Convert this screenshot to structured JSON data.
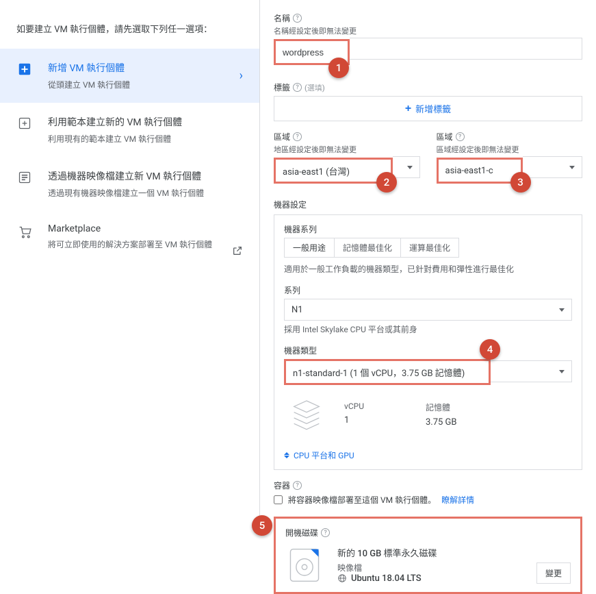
{
  "sidebar": {
    "intro": "如要建立 VM 執行個體，請先選取下列任一選項：",
    "items": [
      {
        "title": "新增 VM 執行個體",
        "subtitle": "從頭建立 VM 執行個體"
      },
      {
        "title": "利用範本建立新的 VM 執行個體",
        "subtitle": "利用現有的範本建立 VM 執行個體"
      },
      {
        "title": "透過機器映像檔建立新 VM 執行個體",
        "subtitle": "透過現有機器映像檔建立一個 VM 執行個體"
      },
      {
        "title": "Marketplace",
        "subtitle": "將可立即使用的解決方案部署至 VM 執行個體"
      }
    ]
  },
  "main": {
    "name_label": "名稱",
    "name_note": "名稱經設定後即無法變更",
    "name_value": "wordpress",
    "labels_label": "標籤",
    "labels_optional": "(選填)",
    "add_label_btn": "新增標籤",
    "region_label": "區域",
    "region_note": "地區經設定後即無法變更",
    "region_value": "asia-east1 (台灣)",
    "zone_label": "區域",
    "zone_note": "區域經設定後即無法變更",
    "zone_value": "asia-east1-c",
    "machine_config_label": "機器設定",
    "series_label": "機器系列",
    "tabs": [
      "一般用途",
      "記憶體最佳化",
      "運算最佳化"
    ],
    "series_desc": "適用於一般工作負載的機器類型，已針對費用和彈性進行最佳化",
    "series_sub_label": "系列",
    "series_value": "N1",
    "series_note": "採用 Intel Skylake CPU 平台或其前身",
    "machine_type_label": "機器類型",
    "machine_type_value": "n1-standard-1 (1 個 vCPU，3.75 GB 記憶體)",
    "vcpu_label": "vCPU",
    "vcpu_value": "1",
    "memory_label": "記憶體",
    "memory_value": "3.75 GB",
    "cpu_gpu_link": "CPU 平台和 GPU",
    "container_label": "容器",
    "container_checkbox": "將容器映像檔部署至這個 VM 執行個體。",
    "container_learn_more": "瞭解詳情",
    "boot_disk_label": "開機磁碟",
    "boot_disk_title": "新的 10 GB 標準永久磁碟",
    "boot_disk_image_label": "映像檔",
    "boot_disk_os": "Ubuntu 18.04 LTS",
    "change_btn": "變更"
  },
  "callouts": [
    "1",
    "2",
    "3",
    "4",
    "5"
  ]
}
